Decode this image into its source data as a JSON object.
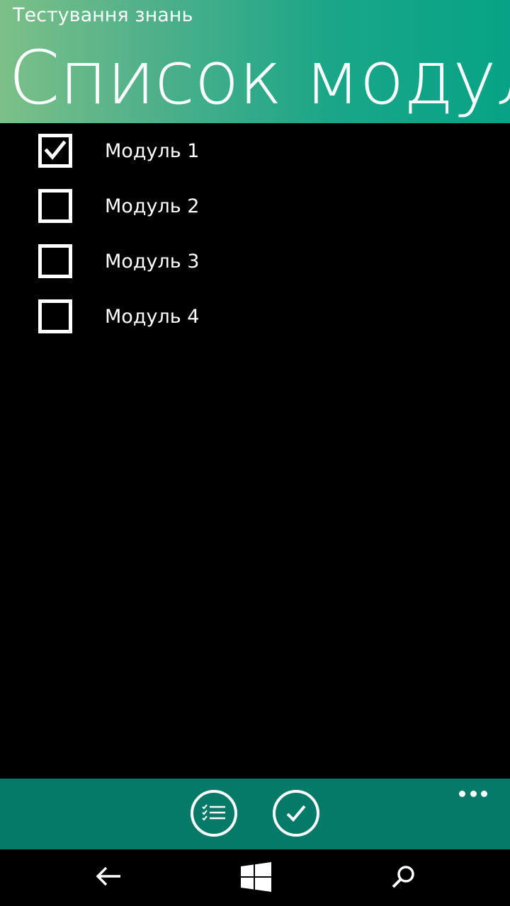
{
  "header": {
    "app_title": "Тестування знань",
    "page_title": "Список модулів"
  },
  "modules": [
    {
      "label": "Модуль 1",
      "checked": true
    },
    {
      "label": "Модуль 2",
      "checked": false
    },
    {
      "label": "Модуль 3",
      "checked": false
    },
    {
      "label": "Модуль 4",
      "checked": false
    }
  ],
  "appbar": {
    "buttons": [
      {
        "icon": "checklist-icon"
      },
      {
        "icon": "checkmark-icon"
      }
    ],
    "more_icon": "ellipsis-icon"
  },
  "navbar": {
    "icons": [
      "back-arrow-icon",
      "windows-logo-icon",
      "search-icon"
    ]
  },
  "colors": {
    "header_gradient_start": "#7cc088",
    "header_gradient_end": "#07a386",
    "appbar": "#057a68",
    "background": "#000000",
    "foreground": "#ffffff"
  }
}
